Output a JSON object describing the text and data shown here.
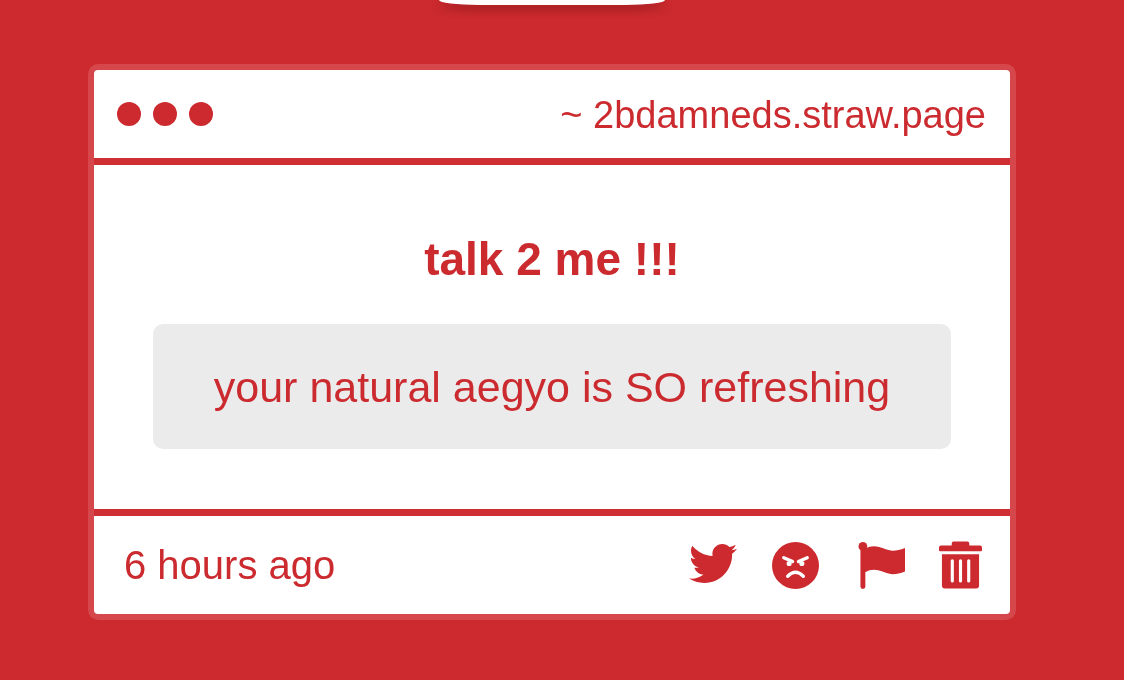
{
  "window": {
    "address": "~ 2bdamneds.straw.page"
  },
  "question": {
    "title": "talk 2 me !!!",
    "message": "your natural aegyo is SO refreshing"
  },
  "footer": {
    "time": "6 hours ago"
  }
}
